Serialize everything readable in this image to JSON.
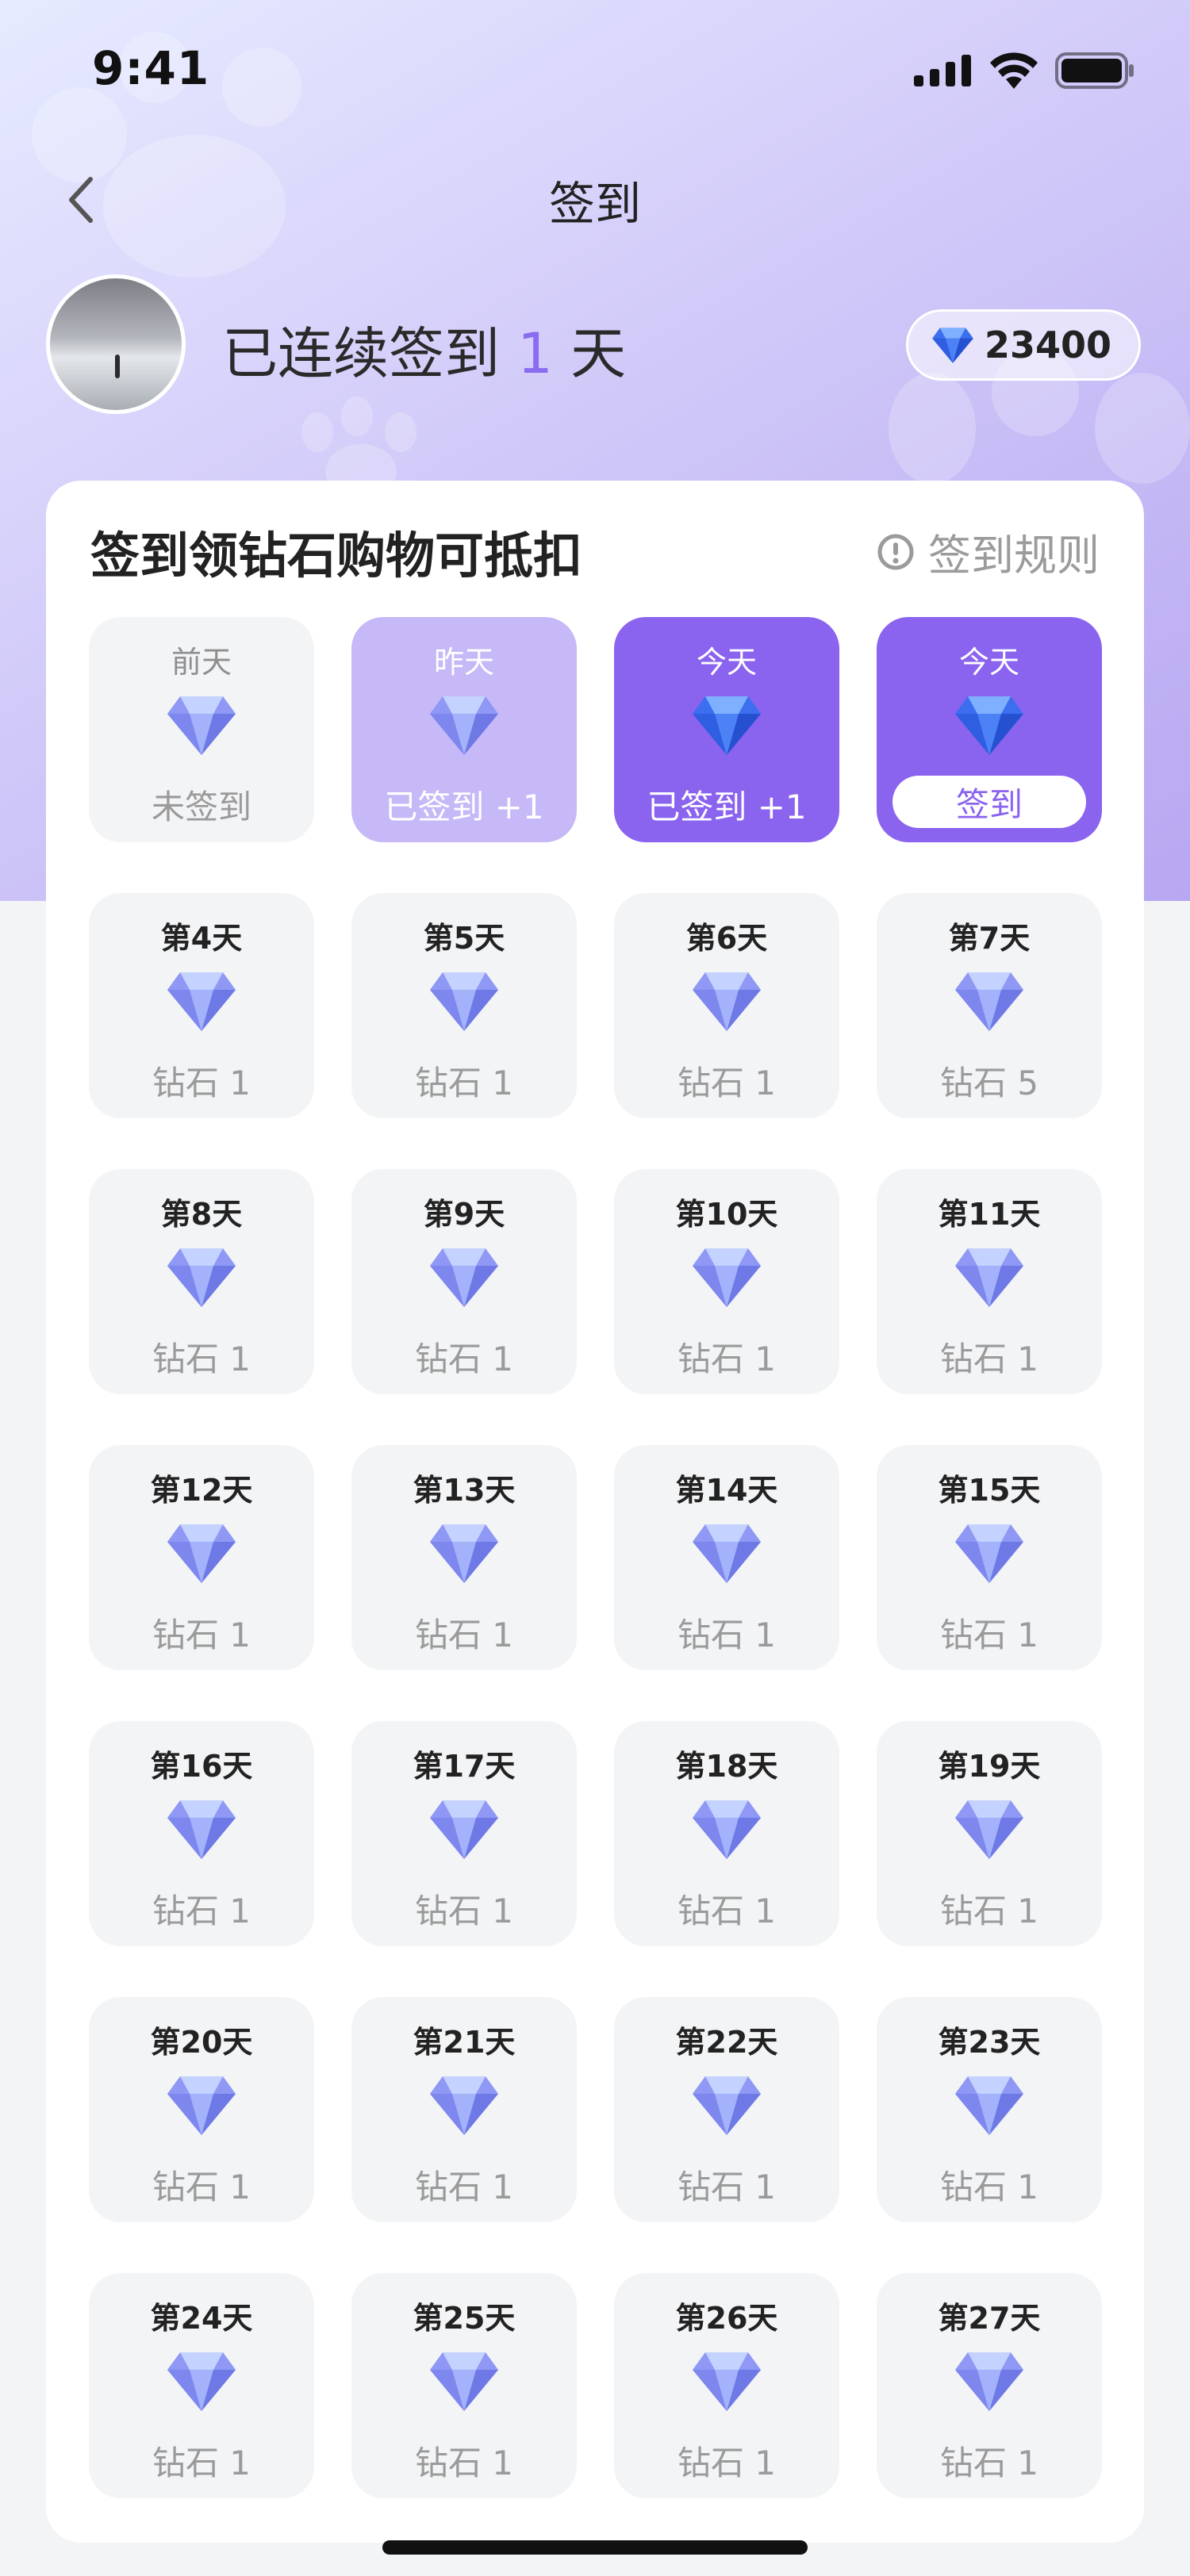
{
  "status_bar": {
    "time": "9:41"
  },
  "nav": {
    "title": "签到",
    "back_icon": "chevron-left-icon"
  },
  "profile": {
    "streak_prefix": "已连续签到",
    "streak_days": "1",
    "streak_suffix": "天",
    "diamond_balance": "23400"
  },
  "card": {
    "title": "签到领钻石购物可抵扣",
    "rules_label": "签到规则"
  },
  "colors": {
    "accent": "#8a63ef",
    "accent_light": "#c7b8f7",
    "cell_bg": "#f3f4f6"
  },
  "days": [
    {
      "label": "前天",
      "reward": "未签到",
      "state": "missed"
    },
    {
      "label": "昨天",
      "reward": "已签到 +1",
      "state": "yesterday"
    },
    {
      "label": "今天",
      "reward": "已签到 +1",
      "state": "signed"
    },
    {
      "label": "今天",
      "reward": "签到",
      "state": "today"
    },
    {
      "label": "第4天",
      "reward": "钻石 1",
      "state": "future"
    },
    {
      "label": "第5天",
      "reward": "钻石 1",
      "state": "future"
    },
    {
      "label": "第6天",
      "reward": "钻石 1",
      "state": "future"
    },
    {
      "label": "第7天",
      "reward": "钻石 5",
      "state": "future"
    },
    {
      "label": "第8天",
      "reward": "钻石 1",
      "state": "future"
    },
    {
      "label": "第9天",
      "reward": "钻石 1",
      "state": "future"
    },
    {
      "label": "第10天",
      "reward": "钻石 1",
      "state": "future"
    },
    {
      "label": "第11天",
      "reward": "钻石 1",
      "state": "future"
    },
    {
      "label": "第12天",
      "reward": "钻石 1",
      "state": "future"
    },
    {
      "label": "第13天",
      "reward": "钻石 1",
      "state": "future"
    },
    {
      "label": "第14天",
      "reward": "钻石 1",
      "state": "future"
    },
    {
      "label": "第15天",
      "reward": "钻石 1",
      "state": "future"
    },
    {
      "label": "第16天",
      "reward": "钻石 1",
      "state": "future"
    },
    {
      "label": "第17天",
      "reward": "钻石 1",
      "state": "future"
    },
    {
      "label": "第18天",
      "reward": "钻石 1",
      "state": "future"
    },
    {
      "label": "第19天",
      "reward": "钻石 1",
      "state": "future"
    },
    {
      "label": "第20天",
      "reward": "钻石 1",
      "state": "future"
    },
    {
      "label": "第21天",
      "reward": "钻石 1",
      "state": "future"
    },
    {
      "label": "第22天",
      "reward": "钻石 1",
      "state": "future"
    },
    {
      "label": "第23天",
      "reward": "钻石 1",
      "state": "future"
    },
    {
      "label": "第24天",
      "reward": "钻石 1",
      "state": "future"
    },
    {
      "label": "第25天",
      "reward": "钻石 1",
      "state": "future"
    },
    {
      "label": "第26天",
      "reward": "钻石 1",
      "state": "future"
    },
    {
      "label": "第27天",
      "reward": "钻石 1",
      "state": "future"
    }
  ]
}
